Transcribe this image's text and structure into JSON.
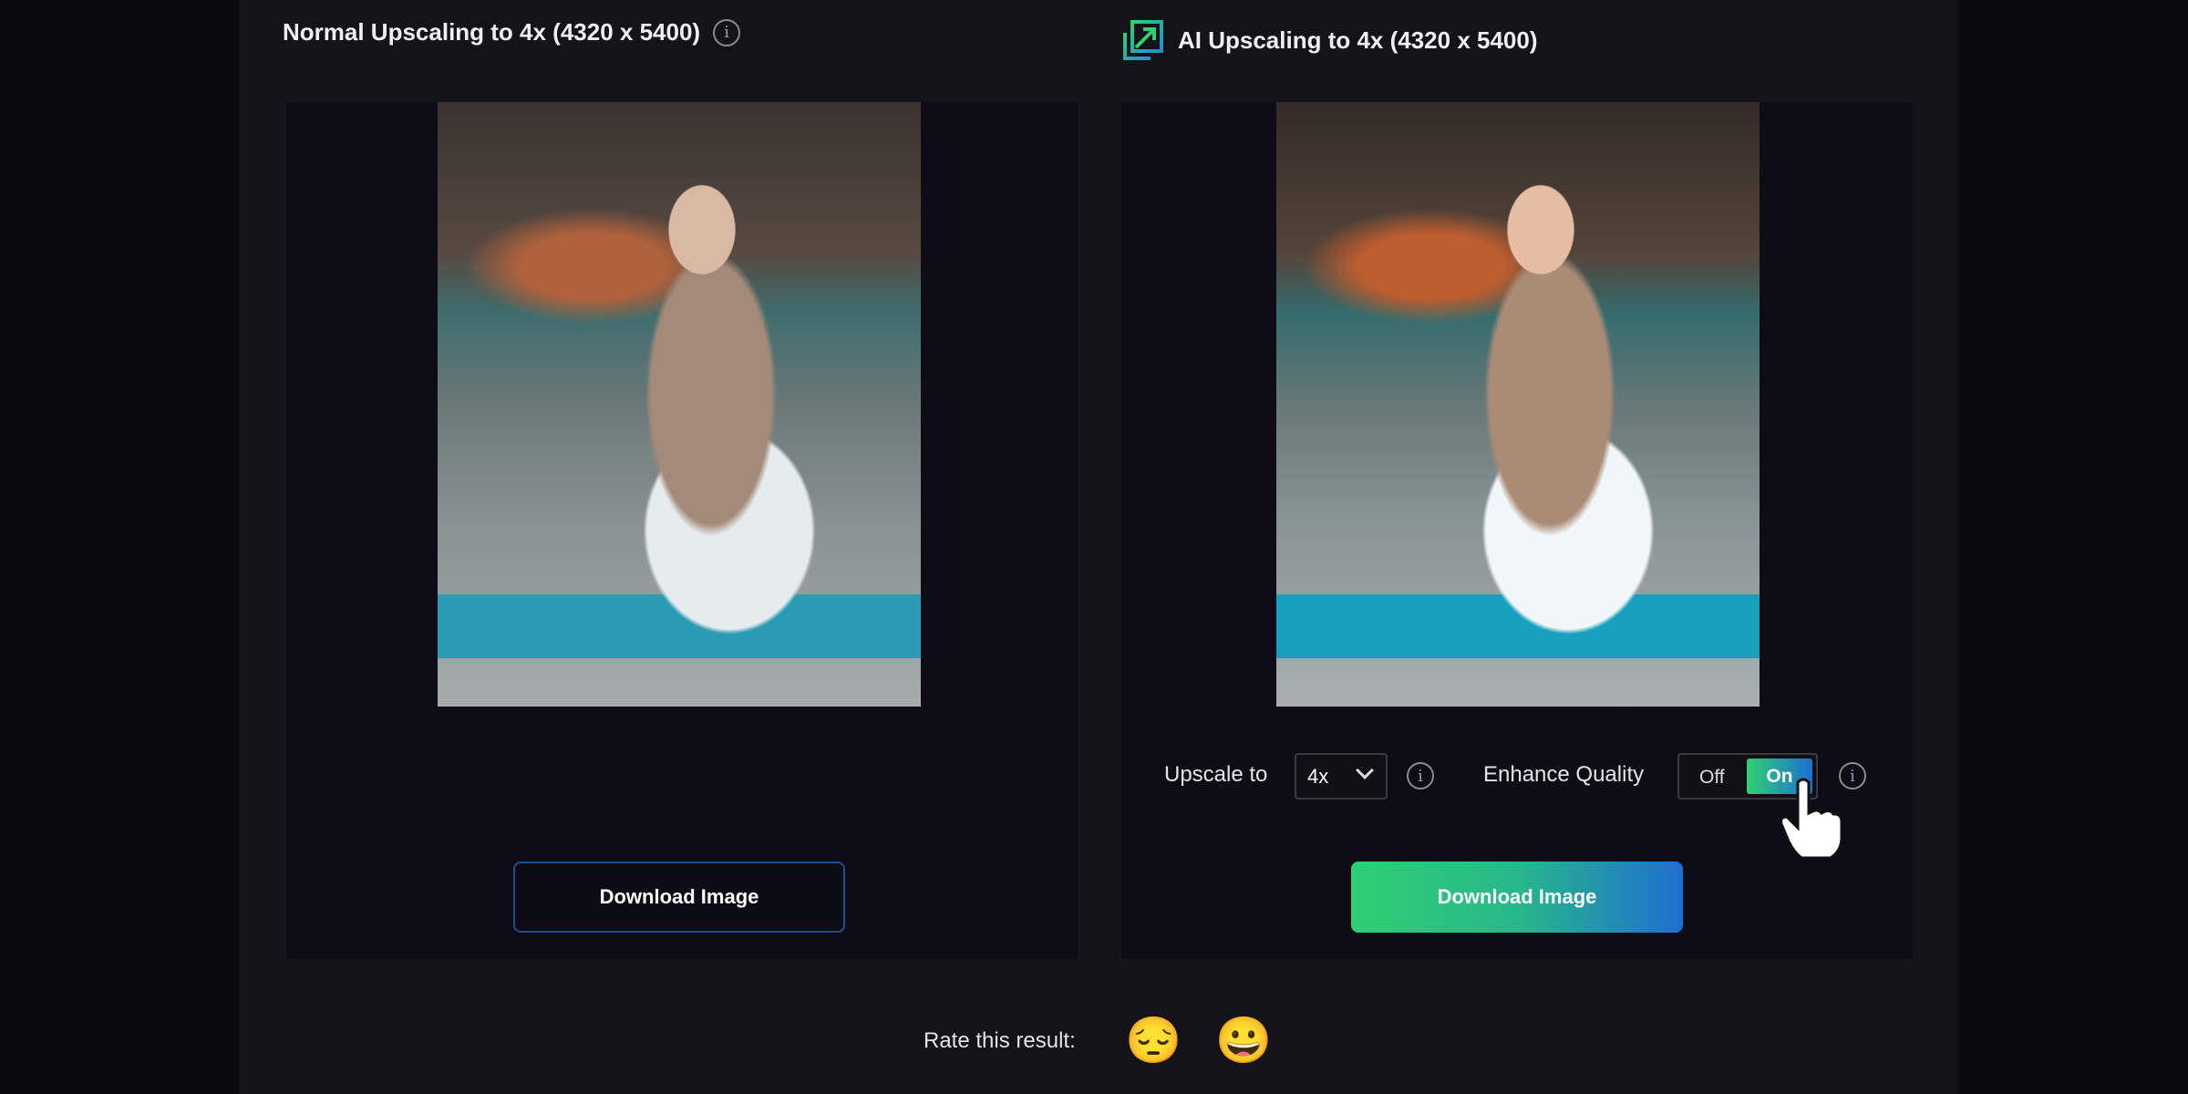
{
  "normal": {
    "title": "Normal Upscaling to 4x (4320 x 5400)",
    "download_label": "Download Image"
  },
  "ai": {
    "title": "AI Upscaling to 4x (4320 x 5400)",
    "download_label": "Download Image",
    "upscale_label": "Upscale to",
    "upscale_value": "4x",
    "enhance_label": "Enhance Quality",
    "toggle_off": "Off",
    "toggle_on": "On",
    "enhance_state": "On"
  },
  "rating": {
    "label": "Rate this result:",
    "sad": "😔",
    "happy": "😀"
  },
  "colors": {
    "accent_green": "#2fcf73",
    "accent_blue": "#1f6fd1",
    "outline_blue": "#1d4f8e"
  }
}
